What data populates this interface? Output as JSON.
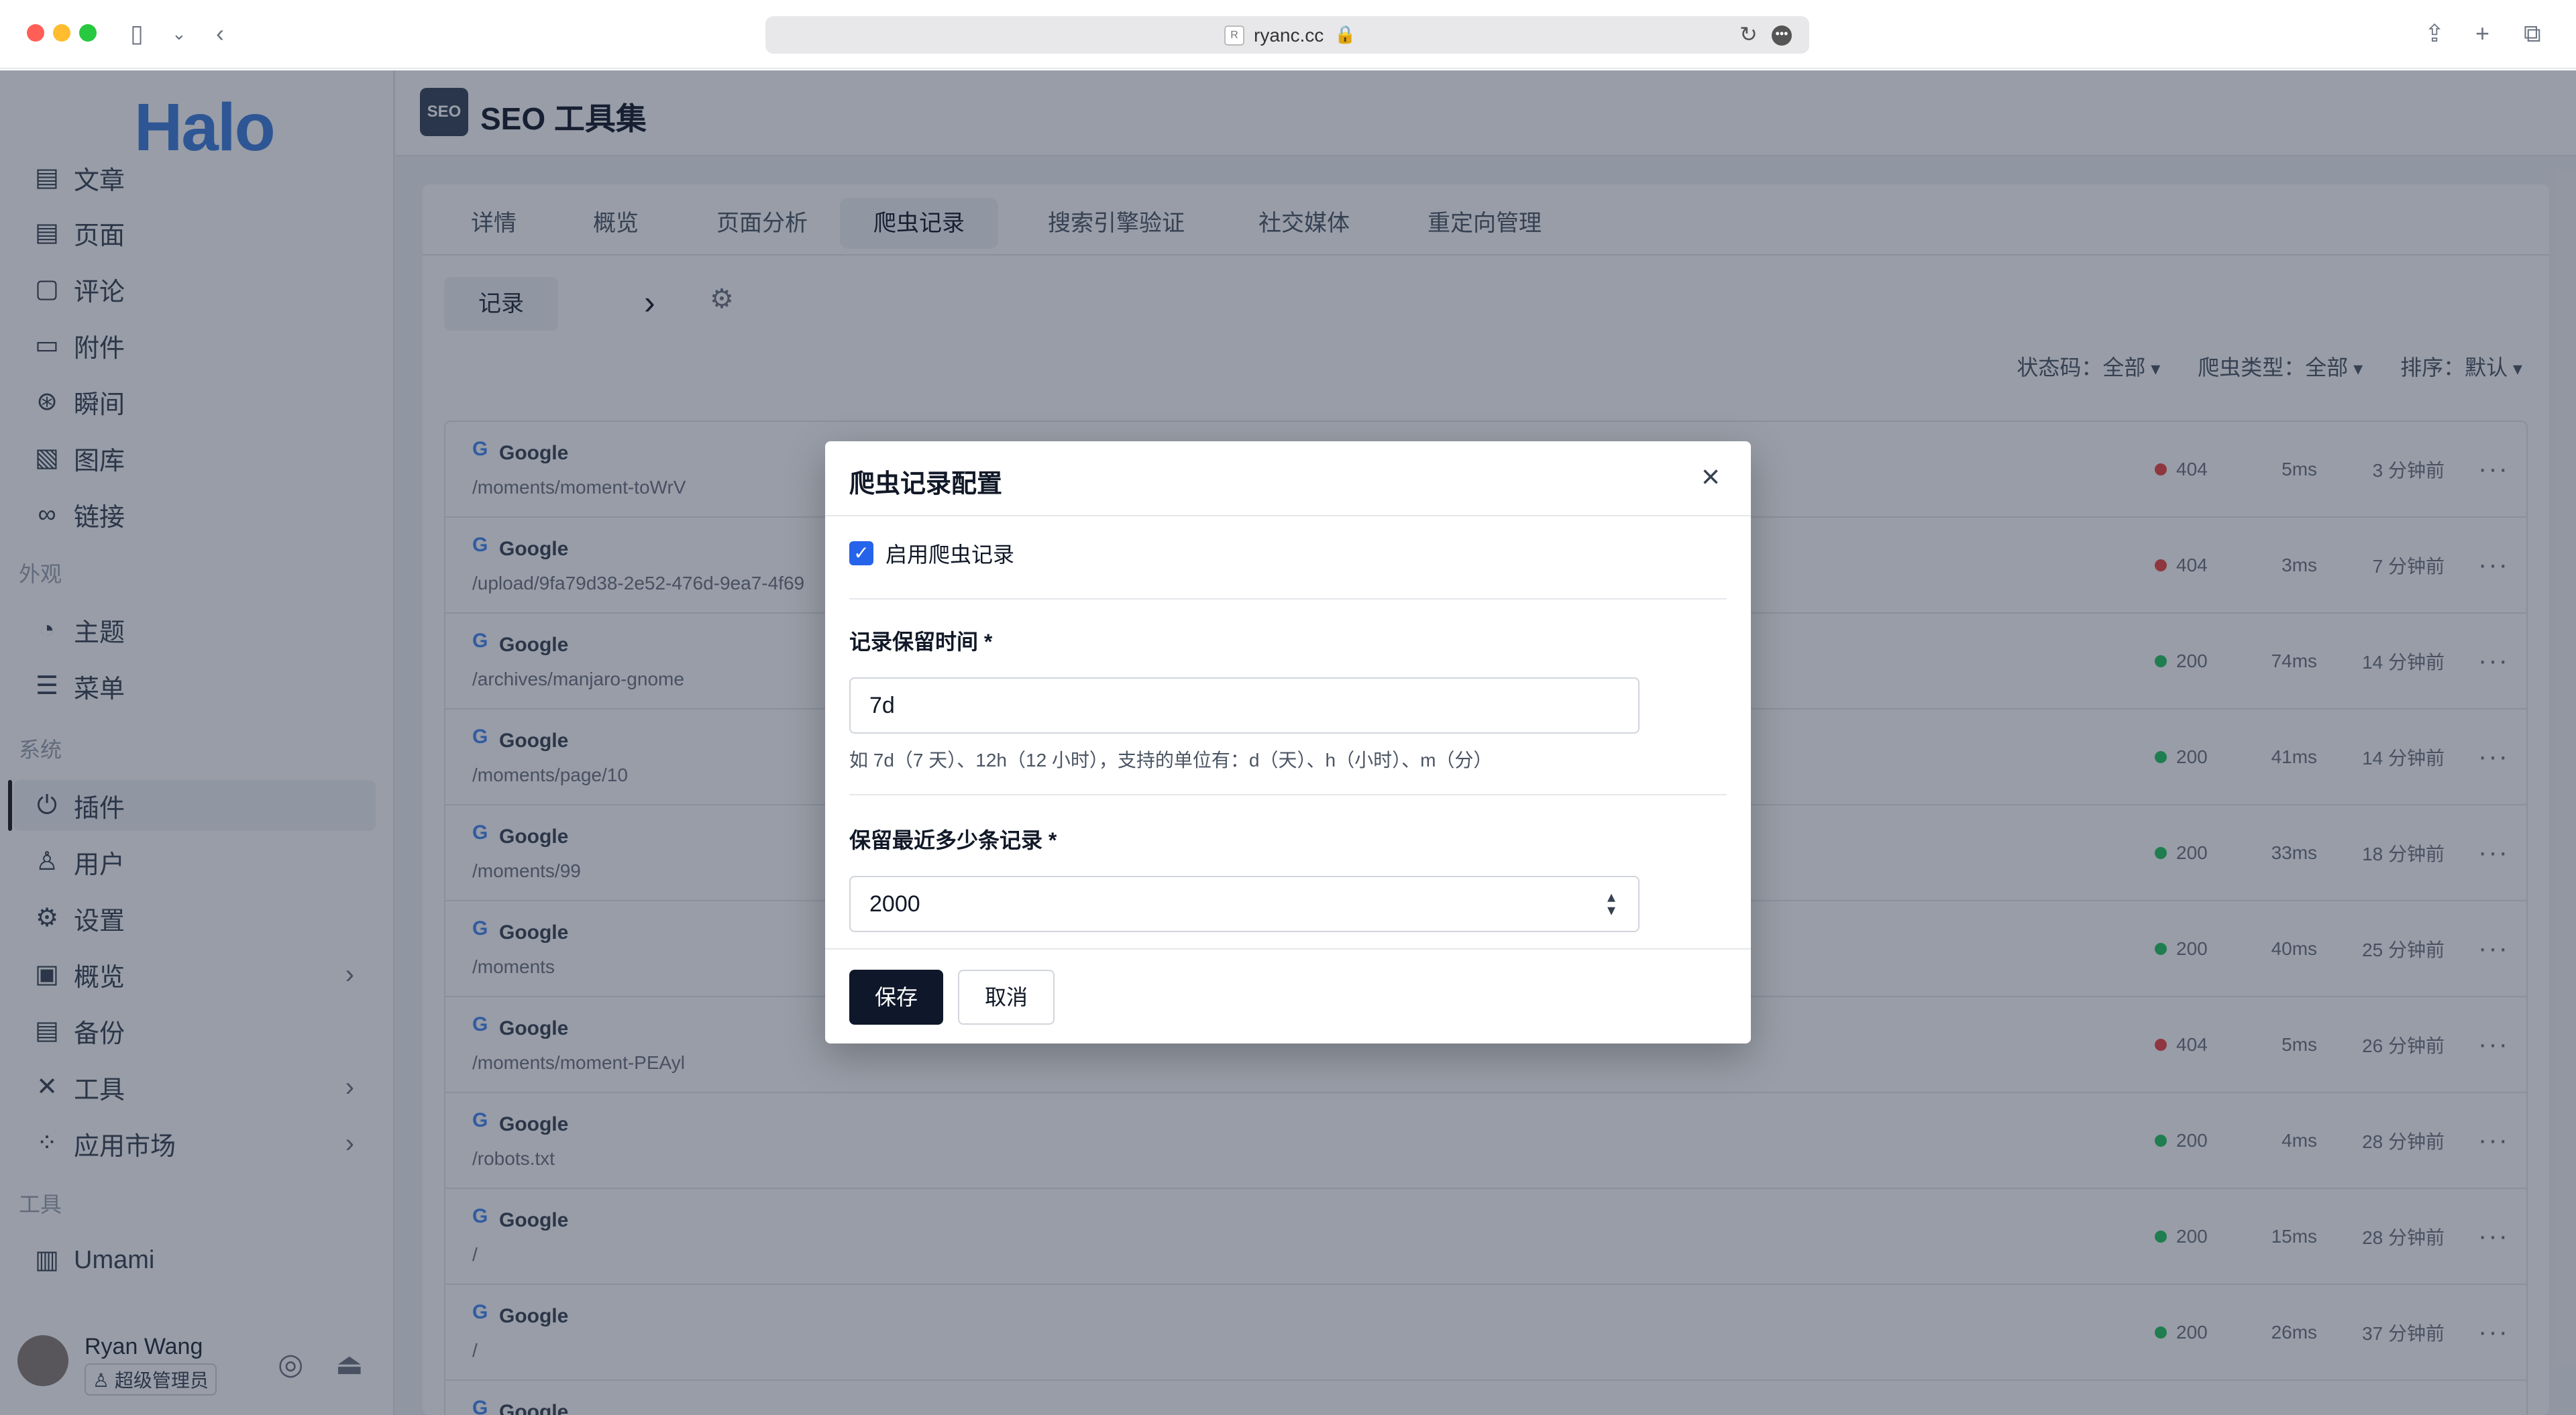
{
  "browser": {
    "url": "ryanc.cc"
  },
  "sidebar": {
    "logo": "Halo",
    "items_top": [
      {
        "label": "文章",
        "icon": "post-icon"
      },
      {
        "label": "页面",
        "icon": "page-icon"
      },
      {
        "label": "评论",
        "icon": "comment-icon"
      },
      {
        "label": "附件",
        "icon": "folder-icon"
      },
      {
        "label": "瞬间",
        "icon": "moments-icon"
      },
      {
        "label": "图库",
        "icon": "image-icon"
      },
      {
        "label": "链接",
        "icon": "link-icon"
      }
    ],
    "section_appearance": "外观",
    "items_appearance": [
      {
        "label": "主题",
        "icon": "palette-icon"
      },
      {
        "label": "菜单",
        "icon": "menu-icon"
      }
    ],
    "section_system": "系统",
    "items_system": [
      {
        "label": "插件",
        "icon": "plugin-icon"
      },
      {
        "label": "用户",
        "icon": "user-icon"
      },
      {
        "label": "设置",
        "icon": "gear-icon"
      },
      {
        "label": "概览",
        "icon": "terminal-icon"
      },
      {
        "label": "备份",
        "icon": "backup-icon"
      },
      {
        "label": "工具",
        "icon": "tools-icon"
      },
      {
        "label": "应用市场",
        "icon": "apps-icon"
      }
    ],
    "section_tools": "工具",
    "items_tools": [
      {
        "label": "Umami",
        "icon": "chart-icon"
      }
    ],
    "user": {
      "name": "Ryan Wang",
      "role": "超级管理员"
    }
  },
  "header": {
    "badge": "SEO",
    "title": "SEO 工具集"
  },
  "tabs": [
    "详情",
    "概览",
    "页面分析",
    "爬虫记录",
    "搜索引擎验证",
    "社交媒体",
    "重定向管理"
  ],
  "subtabs": {
    "records": "记录"
  },
  "filters": {
    "status": "状态码：全部",
    "crawler": "爬虫类型：全部",
    "sort": "排序：默认"
  },
  "rows": [
    {
      "engine": "Google",
      "path": "/moments/moment-toWrV",
      "status": "404",
      "duration": "5ms",
      "time": "3 分钟前"
    },
    {
      "engine": "Google",
      "path": "/upload/9fa79d38-2e52-476d-9ea7-4f69",
      "status": "404",
      "duration": "3ms",
      "time": "7 分钟前"
    },
    {
      "engine": "Google",
      "path": "/archives/manjaro-gnome",
      "status": "200",
      "duration": "74ms",
      "time": "14 分钟前"
    },
    {
      "engine": "Google",
      "path": "/moments/page/10",
      "status": "200",
      "duration": "41ms",
      "time": "14 分钟前"
    },
    {
      "engine": "Google",
      "path": "/moments/99",
      "status": "200",
      "duration": "33ms",
      "time": "18 分钟前"
    },
    {
      "engine": "Google",
      "path": "/moments",
      "status": "200",
      "duration": "40ms",
      "time": "25 分钟前"
    },
    {
      "engine": "Google",
      "path": "/moments/moment-PEAyl",
      "status": "404",
      "duration": "5ms",
      "time": "26 分钟前"
    },
    {
      "engine": "Google",
      "path": "/robots.txt",
      "status": "200",
      "duration": "4ms",
      "time": "28 分钟前"
    },
    {
      "engine": "Google",
      "path": "/",
      "status": "200",
      "duration": "15ms",
      "time": "28 分钟前"
    },
    {
      "engine": "Google",
      "path": "/",
      "status": "200",
      "duration": "26ms",
      "time": "37 分钟前"
    },
    {
      "engine": "Google",
      "path": "",
      "status": "",
      "duration": "",
      "time": ""
    }
  ],
  "colors": {
    "status_ok": "#22c55e",
    "status_error": "#ef4444",
    "primary": "#0f172a",
    "checkbox": "#2563eb"
  },
  "modal": {
    "title": "爬虫记录配置",
    "enable_label": "启用爬虫记录",
    "retention_label": "记录保留时间 *",
    "retention_value": "7d",
    "retention_help": "如 7d（7 天）、12h（12 小时），支持的单位有：d（天）、h（小时）、m（分）",
    "max_label": "保留最近多少条记录 *",
    "max_value": "2000",
    "save": "保存",
    "cancel": "取消"
  }
}
